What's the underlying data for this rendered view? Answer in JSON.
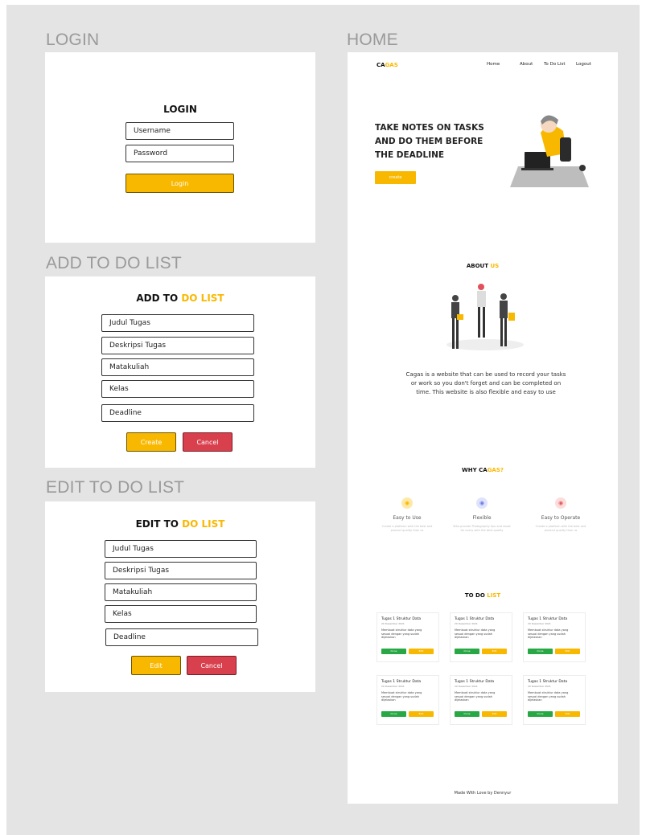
{
  "sections": {
    "login": "LOGIN",
    "add": "ADD TO DO LIST",
    "edit": "EDIT TO DO LIST",
    "home": "HOME"
  },
  "login": {
    "title": "LOGIN",
    "username_placeholder": "Username",
    "password_placeholder": "Password",
    "button": "Login"
  },
  "add_form": {
    "title_main": "ADD TO ",
    "title_accent": "DO LIST",
    "fields": [
      "Judul Tugas",
      "Deskripsi Tugas",
      "Matakuliah",
      "Kelas",
      "Deadline"
    ],
    "create": "Create",
    "cancel": "Cancel"
  },
  "edit_form": {
    "title_main": "EDIT TO ",
    "title_accent": "DO LIST",
    "fields": [
      "Judul Tugas",
      "Deskripsi Tugas",
      "Matakuliah",
      "Kelas",
      "Deadline"
    ],
    "edit": "Edit",
    "cancel": "Cancel"
  },
  "home": {
    "logo_main": "CA",
    "logo_accent": "GAS",
    "nav": [
      "Home",
      "About",
      "To Do List",
      "Logout"
    ],
    "hero_title": "TAKE NOTES ON TASKS AND DO THEM BEFORE THE DEADLINE",
    "hero_button": "create",
    "about_main": "ABOUT ",
    "about_accent": "US",
    "about_text": "Cagas is a website that can be used to record your tasks or work so you don't forget and can be completed on time. This website is also flexible and easy to use",
    "why_main": "WHY CA",
    "why_accent": "GAS?",
    "why_items": [
      {
        "title": "Easy to Use",
        "desc": "Create a platform with the best and product quality than us",
        "color": "#fde9a8",
        "icon_color": "#f9b800"
      },
      {
        "title": "Flexible",
        "desc": "Who provide Photography tips and shoot for every with the best quality",
        "color": "#dfe3fb",
        "icon_color": "#6f7ee8"
      },
      {
        "title": "Easy to Operate",
        "desc": "Create a platform with the best and product quality than us",
        "color": "#fcdcdc",
        "icon_color": "#e25a5a"
      }
    ],
    "todo_main": "TO DO ",
    "todo_accent": "LIST",
    "cards": [
      {
        "title": "Tugas 1 Struktur Data",
        "date": "20 Desember 2021",
        "text": "Membuat struktur data yang sesuai dengan yang sudah dijelaskan",
        "done": "Done",
        "edit": "Edit"
      },
      {
        "title": "Tugas 1 Struktur Data",
        "date": "20 Desember 2021",
        "text": "Membuat struktur data yang sesuai dengan yang sudah dijelaskan",
        "done": "Done",
        "edit": "Edit"
      },
      {
        "title": "Tugas 1 Struktur Data",
        "date": "20 Desember 2021",
        "text": "Membuat struktur data yang sesuai dengan yang sudah dijelaskan",
        "done": "Done",
        "edit": "Edit"
      },
      {
        "title": "Tugas 1 Struktur Data",
        "date": "20 Desember 2021",
        "text": "Membuat struktur data yang sesuai dengan yang sudah dijelaskan",
        "done": "Done",
        "edit": "Edit"
      },
      {
        "title": "Tugas 1 Struktur Data",
        "date": "20 Desember 2021",
        "text": "Membuat struktur data yang sesuai dengan yang sudah dijelaskan",
        "done": "Done",
        "edit": "Edit"
      },
      {
        "title": "Tugas 1 Struktur Data",
        "date": "20 Desember 2021",
        "text": "Membuat struktur data yang sesuai dengan yang sudah dijelaskan",
        "done": "Done",
        "edit": "Edit"
      }
    ],
    "footer": "Made With Love by Dennyur"
  },
  "colors": {
    "accent": "#f9b800",
    "cancel": "#d9404e",
    "done": "#27a844",
    "canvas": "#e4e4e4"
  }
}
